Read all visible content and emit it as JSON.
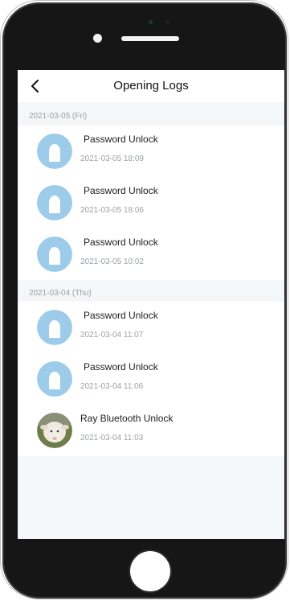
{
  "header": {
    "title": "Opening Logs"
  },
  "groups": [
    {
      "date": "2021-03-05 (Fri)",
      "entries": [
        {
          "title": "Password Unlock",
          "time": "2021-03-05 18:09",
          "avatar": "default-user-icon"
        },
        {
          "title": "Password Unlock",
          "time": "2021-03-05 18:06",
          "avatar": "default-user-icon"
        },
        {
          "title": "Password Unlock",
          "time": "2021-03-05 10:02",
          "avatar": "default-user-icon"
        }
      ]
    },
    {
      "date": "2021-03-04 (Thu)",
      "entries": [
        {
          "title": "Password Unlock",
          "time": "2021-03-04 11:07",
          "avatar": "default-user-icon"
        },
        {
          "title": "Password Unlock",
          "time": "2021-03-04 11:06",
          "avatar": "default-user-icon"
        },
        {
          "title": "Ray Bluetooth Unlock",
          "time": "2021-03-04 11:03",
          "avatar": "sheep-photo"
        }
      ]
    }
  ],
  "colors": {
    "avatar_bg": "#9dcbea",
    "page_bg": "#f4f7f8",
    "muted_text": "#9aa0a6"
  }
}
